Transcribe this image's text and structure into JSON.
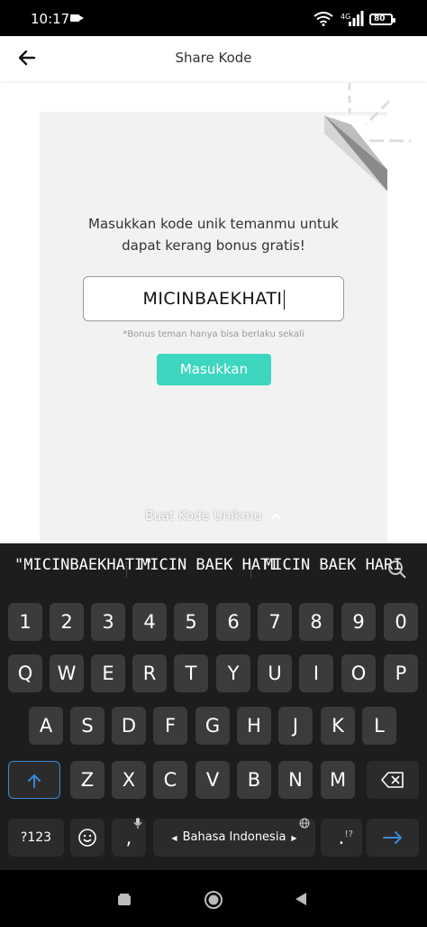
{
  "status": {
    "time": "10:17",
    "network": "4G",
    "battery": "80"
  },
  "header": {
    "title": "Share Kode"
  },
  "card": {
    "prompt_line1": "Masukkan kode unik temanmu untuk",
    "prompt_line2": "dapat kerang bonus gratis!",
    "code_value": "MICINBAEKHATI",
    "note": "*Bonus teman hanya bisa berlaku sekali",
    "submit_label": "Masukkan",
    "create_label": "Buat Kode Unikmu"
  },
  "keyboard": {
    "suggestions": [
      "\"MICINBAEKHATI\"",
      "MICIN BAEK HATI",
      "MICIN BAEK HARI"
    ],
    "row_numbers": [
      "1",
      "2",
      "3",
      "4",
      "5",
      "6",
      "7",
      "8",
      "9",
      "0"
    ],
    "row1": [
      "Q",
      "W",
      "E",
      "R",
      "T",
      "Y",
      "U",
      "I",
      "O",
      "P"
    ],
    "row2": [
      "A",
      "S",
      "D",
      "F",
      "G",
      "H",
      "J",
      "K",
      "L"
    ],
    "row3": [
      "Z",
      "X",
      "C",
      "V",
      "B",
      "N",
      "M"
    ],
    "symbols_label": "?123",
    "comma": ",",
    "space_label": "Bahasa Indonesia",
    "period": ".",
    "period_sub": "!?",
    "accent_color": "#3a8ad6"
  },
  "colors": {
    "button": "#3ed6bf",
    "card": "#f2f2f2"
  }
}
